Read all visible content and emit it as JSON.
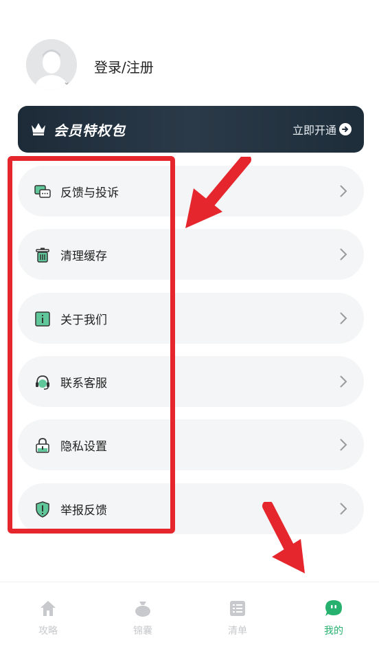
{
  "profile": {
    "login_label": "登录/注册"
  },
  "vip": {
    "title": "会员特权包",
    "open_label": "立即开通"
  },
  "menu": [
    {
      "label": "反馈与投诉",
      "icon": "feedback-chat-icon"
    },
    {
      "label": "清理缓存",
      "icon": "trash-icon"
    },
    {
      "label": "关于我们",
      "icon": "info-card-icon"
    },
    {
      "label": "联系客服",
      "icon": "headset-icon"
    },
    {
      "label": "隐私设置",
      "icon": "lock-icon"
    },
    {
      "label": "举报反馈",
      "icon": "shield-alert-icon"
    }
  ],
  "tabs": [
    {
      "label": "攻略",
      "icon": "home-icon"
    },
    {
      "label": "锦囊",
      "icon": "bag-icon"
    },
    {
      "label": "清单",
      "icon": "list-icon"
    },
    {
      "label": "我的",
      "icon": "chat-face-icon",
      "active": true
    }
  ],
  "colors": {
    "accent": "#26b26e",
    "annotation": "#e5262d",
    "vip_bg": "#1f2d3a"
  }
}
